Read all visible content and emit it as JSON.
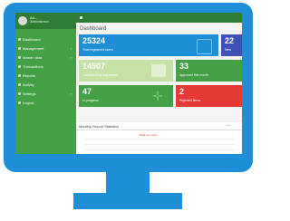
{
  "sidebar": {
    "user_name": "Ad...",
    "user_role": "Administrator...",
    "items": [
      {
        "label": "Dashboard",
        "caret": ""
      },
      {
        "label": "Management",
        "caret": "›"
      },
      {
        "label": "Master data",
        "caret": "›"
      },
      {
        "label": "Transactions",
        "caret": ""
      },
      {
        "label": "Reports",
        "caret": ""
      },
      {
        "label": "Activity",
        "caret": ""
      },
      {
        "label": "Settings",
        "caret": "›"
      },
      {
        "label": "Logout",
        "caret": ""
      }
    ]
  },
  "header": {
    "title": "Dashboard"
  },
  "cards": [
    {
      "value": "25324",
      "label": "Total registered users",
      "color": "#1e8ed6"
    },
    {
      "value": "22",
      "label": "New",
      "color": "#3f51b5"
    },
    {
      "value": "14507",
      "label": "Total pending documents",
      "color": "#c5e1a5"
    },
    {
      "value": "33",
      "label": "Approved this month",
      "color": "#43a047"
    },
    {
      "value": "47",
      "label": "In progress",
      "color": "#43a047"
    },
    {
      "value": "2",
      "label": "Rejected items",
      "color": "#e53935"
    }
  ],
  "panel": {
    "title": "Monthly Report Statistics",
    "subtitle": "Data summary",
    "close": "—"
  },
  "colors": {
    "frame": "#1e8ed6",
    "sidebar": "#43a047",
    "sidebar_dark": "#2e7d32"
  }
}
